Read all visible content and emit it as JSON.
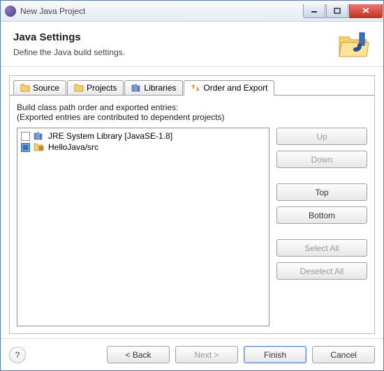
{
  "window": {
    "title": "New Java Project"
  },
  "header": {
    "title": "Java Settings",
    "subtitle": "Define the Java build settings."
  },
  "tabs": {
    "0": {
      "label": "Source"
    },
    "1": {
      "label": "Projects"
    },
    "2": {
      "label": "Libraries"
    },
    "3": {
      "label": "Order and Export"
    }
  },
  "content": {
    "line1": "Build class path order and exported entries:",
    "line2": "(Exported entries are contributed to dependent projects)"
  },
  "list": {
    "items": [
      {
        "label": "JRE System Library [JavaSE-1.8]",
        "checked": false
      },
      {
        "label": "HelloJava/src",
        "checked": true
      }
    ]
  },
  "side_buttons": {
    "up": "Up",
    "down": "Down",
    "top": "Top",
    "bottom": "Bottom",
    "select_all": "Select All",
    "deselect_all": "Deselect All"
  },
  "footer": {
    "back": "< Back",
    "next": "Next >",
    "finish": "Finish",
    "cancel": "Cancel"
  }
}
